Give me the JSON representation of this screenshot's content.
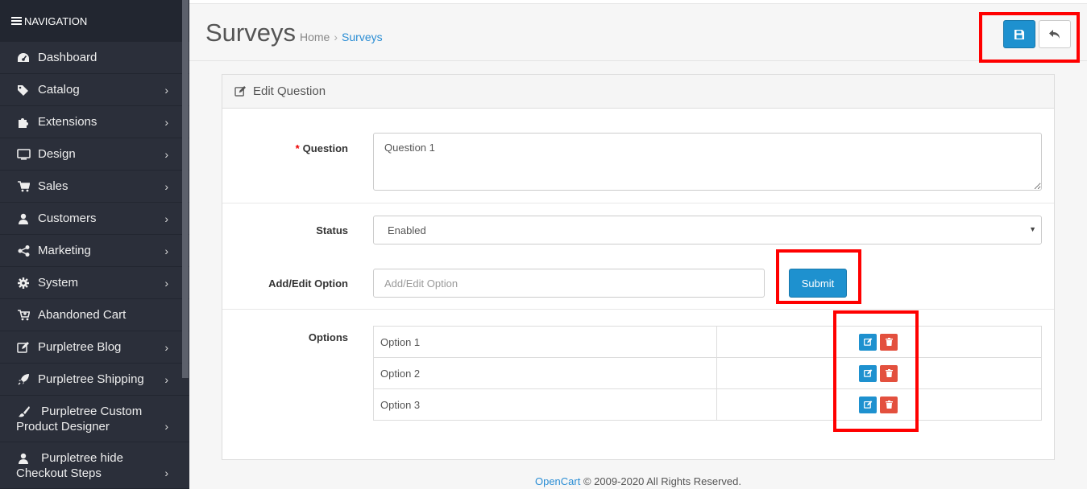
{
  "sidebar": {
    "header": "NAVIGATION",
    "items": [
      {
        "label": "Dashboard",
        "icon": "dashboard-icon",
        "submenu": false
      },
      {
        "label": "Catalog",
        "icon": "tags-icon",
        "submenu": true
      },
      {
        "label": "Extensions",
        "icon": "puzzle-icon",
        "submenu": true
      },
      {
        "label": "Design",
        "icon": "monitor-icon",
        "submenu": true
      },
      {
        "label": "Sales",
        "icon": "cart-icon",
        "submenu": true
      },
      {
        "label": "Customers",
        "icon": "user-icon",
        "submenu": true
      },
      {
        "label": "Marketing",
        "icon": "share-icon",
        "submenu": true
      },
      {
        "label": "System",
        "icon": "gear-icon",
        "submenu": true
      },
      {
        "label": "Abandoned Cart",
        "icon": "cart-plus-icon",
        "submenu": false
      },
      {
        "label": "Purpletree Blog",
        "icon": "edit-icon",
        "submenu": true
      },
      {
        "label": "Purpletree Shipping",
        "icon": "rocket-icon",
        "submenu": true
      },
      {
        "label": "Purpletree Custom Product Designer",
        "icon": "brush-icon",
        "submenu": true
      },
      {
        "label": "Purpletree hide Checkout Steps",
        "icon": "user-icon",
        "submenu": true
      }
    ]
  },
  "header": {
    "title": "Surveys",
    "breadcrumb": [
      "Home",
      "Surveys"
    ]
  },
  "panel": {
    "title": "Edit Question",
    "question_label": "Question",
    "question_value": "Question 1",
    "status_label": "Status",
    "status_value": "Enabled",
    "option_label": "Add/Edit Option",
    "option_placeholder": "Add/Edit Option",
    "submit_label": "Submit",
    "options_label": "Options",
    "options": [
      "Option 1",
      "Option 2",
      "Option 3"
    ]
  },
  "footer": {
    "link": "OpenCart",
    "text": "© 2009-2020 All Rights Reserved."
  },
  "colors": {
    "primary": "#1e91cf",
    "danger": "#e3503e",
    "sidebar": "#2b2f3a",
    "highlight": "#ff0000"
  }
}
